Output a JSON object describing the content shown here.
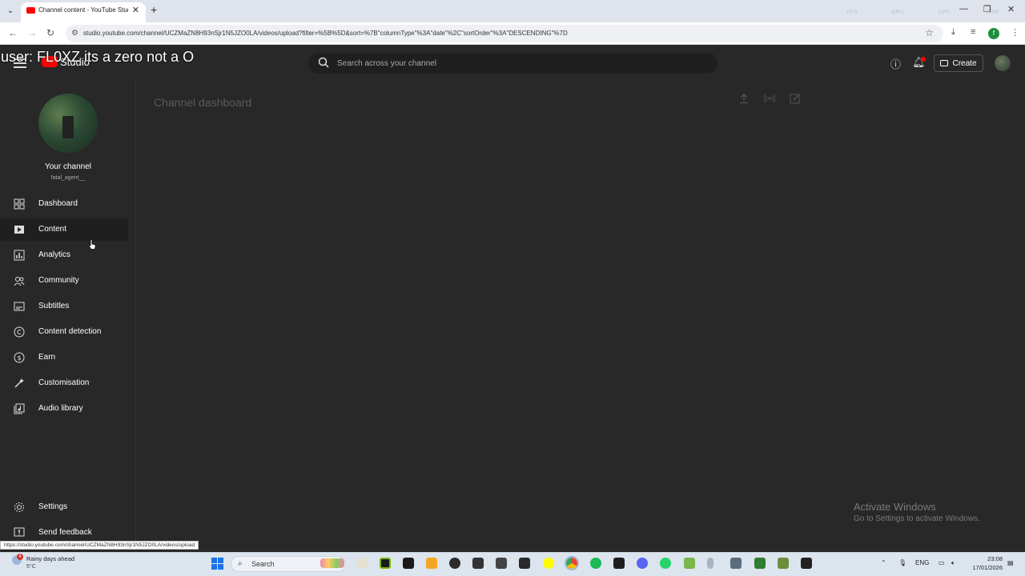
{
  "browser": {
    "tab_title": "Channel content - YouTube Studio",
    "url": "studio.youtube.com/channel/UCZMaZN8H93nSjr1N5JZO0LA/videos/upload?filter=%5B%5D&sort=%7B\"columnType\"%3A\"date\"%2C\"sortOrder\"%3A\"DESCENDING\"%7D",
    "profile_initial": "f",
    "status_url": "https://studio.youtube.com/channel/UCZMaZN8H93nSjr1N5JZO0LA/videos/upload",
    "perf": [
      "FPS",
      "GPU",
      "CPU",
      "RAM"
    ]
  },
  "overlay_text": "user: FL0XZ its a zero not a O",
  "header": {
    "logo_text": "Studio",
    "search_placeholder": "Search across your channel",
    "create_label": "Create"
  },
  "channel": {
    "title": "Your channel",
    "handle": "fatal_agent__"
  },
  "sidebar": {
    "items": [
      {
        "label": "Dashboard",
        "icon": "dashboard-icon"
      },
      {
        "label": "Content",
        "icon": "content-icon",
        "active": true
      },
      {
        "label": "Analytics",
        "icon": "analytics-icon"
      },
      {
        "label": "Community",
        "icon": "community-icon"
      },
      {
        "label": "Subtitles",
        "icon": "subtitles-icon"
      },
      {
        "label": "Content detection",
        "icon": "copyright-icon"
      },
      {
        "label": "Earn",
        "icon": "earn-icon"
      },
      {
        "label": "Customisation",
        "icon": "customisation-icon"
      },
      {
        "label": "Audio library",
        "icon": "audio-library-icon"
      }
    ],
    "footer": [
      {
        "label": "Settings",
        "icon": "gear-icon"
      },
      {
        "label": "Send feedback",
        "icon": "feedback-icon"
      }
    ]
  },
  "main": {
    "page_title": "Channel dashboard"
  },
  "watermark": {
    "line1": "Activate Windows",
    "line2": "Go to Settings to activate Windows."
  },
  "taskbar": {
    "weather_title": "Rainy days ahead",
    "weather_temp": "5°C",
    "weather_badge": "4",
    "search_label": "Search",
    "lang": "ENG",
    "time": "23:08",
    "date": "17/01/2026"
  },
  "colors": {
    "accent": "#ff0000",
    "background": "#282828"
  }
}
